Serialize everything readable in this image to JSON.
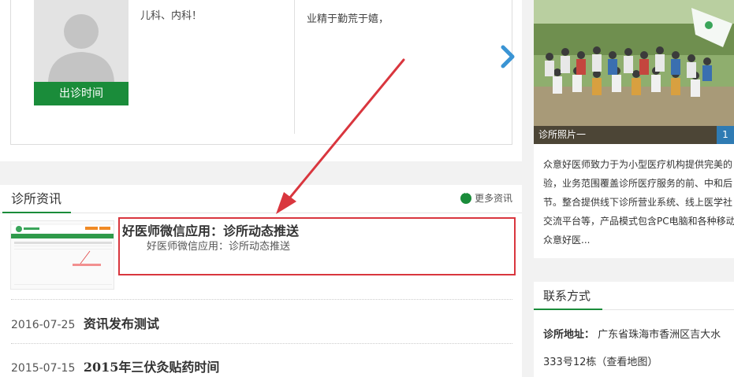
{
  "doctor": {
    "schedule_button": "出诊时间",
    "department": "儿科、内科！",
    "bio": "业精于勤荒于嬉，"
  },
  "news": {
    "section_title": "诊所资讯",
    "more_label": "更多资讯",
    "featured": {
      "title": "好医师微信应用：诊所动态推送",
      "subtitle": "好医师微信应用：诊所动态推送"
    },
    "items": [
      {
        "date": "2016-07-25",
        "title": "资讯发布测试"
      },
      {
        "date": "2015-07-15",
        "title": "2015年三伏灸贴药时间"
      }
    ]
  },
  "gallery": {
    "caption": "诊所照片一",
    "index": "1"
  },
  "intro": {
    "lines": [
      "众意好医师致力于为小型医疗机构提供完美的",
      "验，业务范围覆盖诊所医疗服务的前、中和后",
      "节。整合提供线下诊所营业系统、线上医学社",
      "交流平台等，产品模式包含PC电脑和各种移动",
      "众意好医..."
    ]
  },
  "contact": {
    "section_title": "联系方式",
    "address_label": "诊所地址：",
    "address_value": "广东省珠海市香洲区吉大水",
    "address_line2": "333号12栋（查看地图）"
  },
  "colors": {
    "brand_green": "#1a8c3a",
    "highlight_red": "#d9363e",
    "arrow_red": "#d9363e",
    "link_blue": "#2f7bb3"
  }
}
